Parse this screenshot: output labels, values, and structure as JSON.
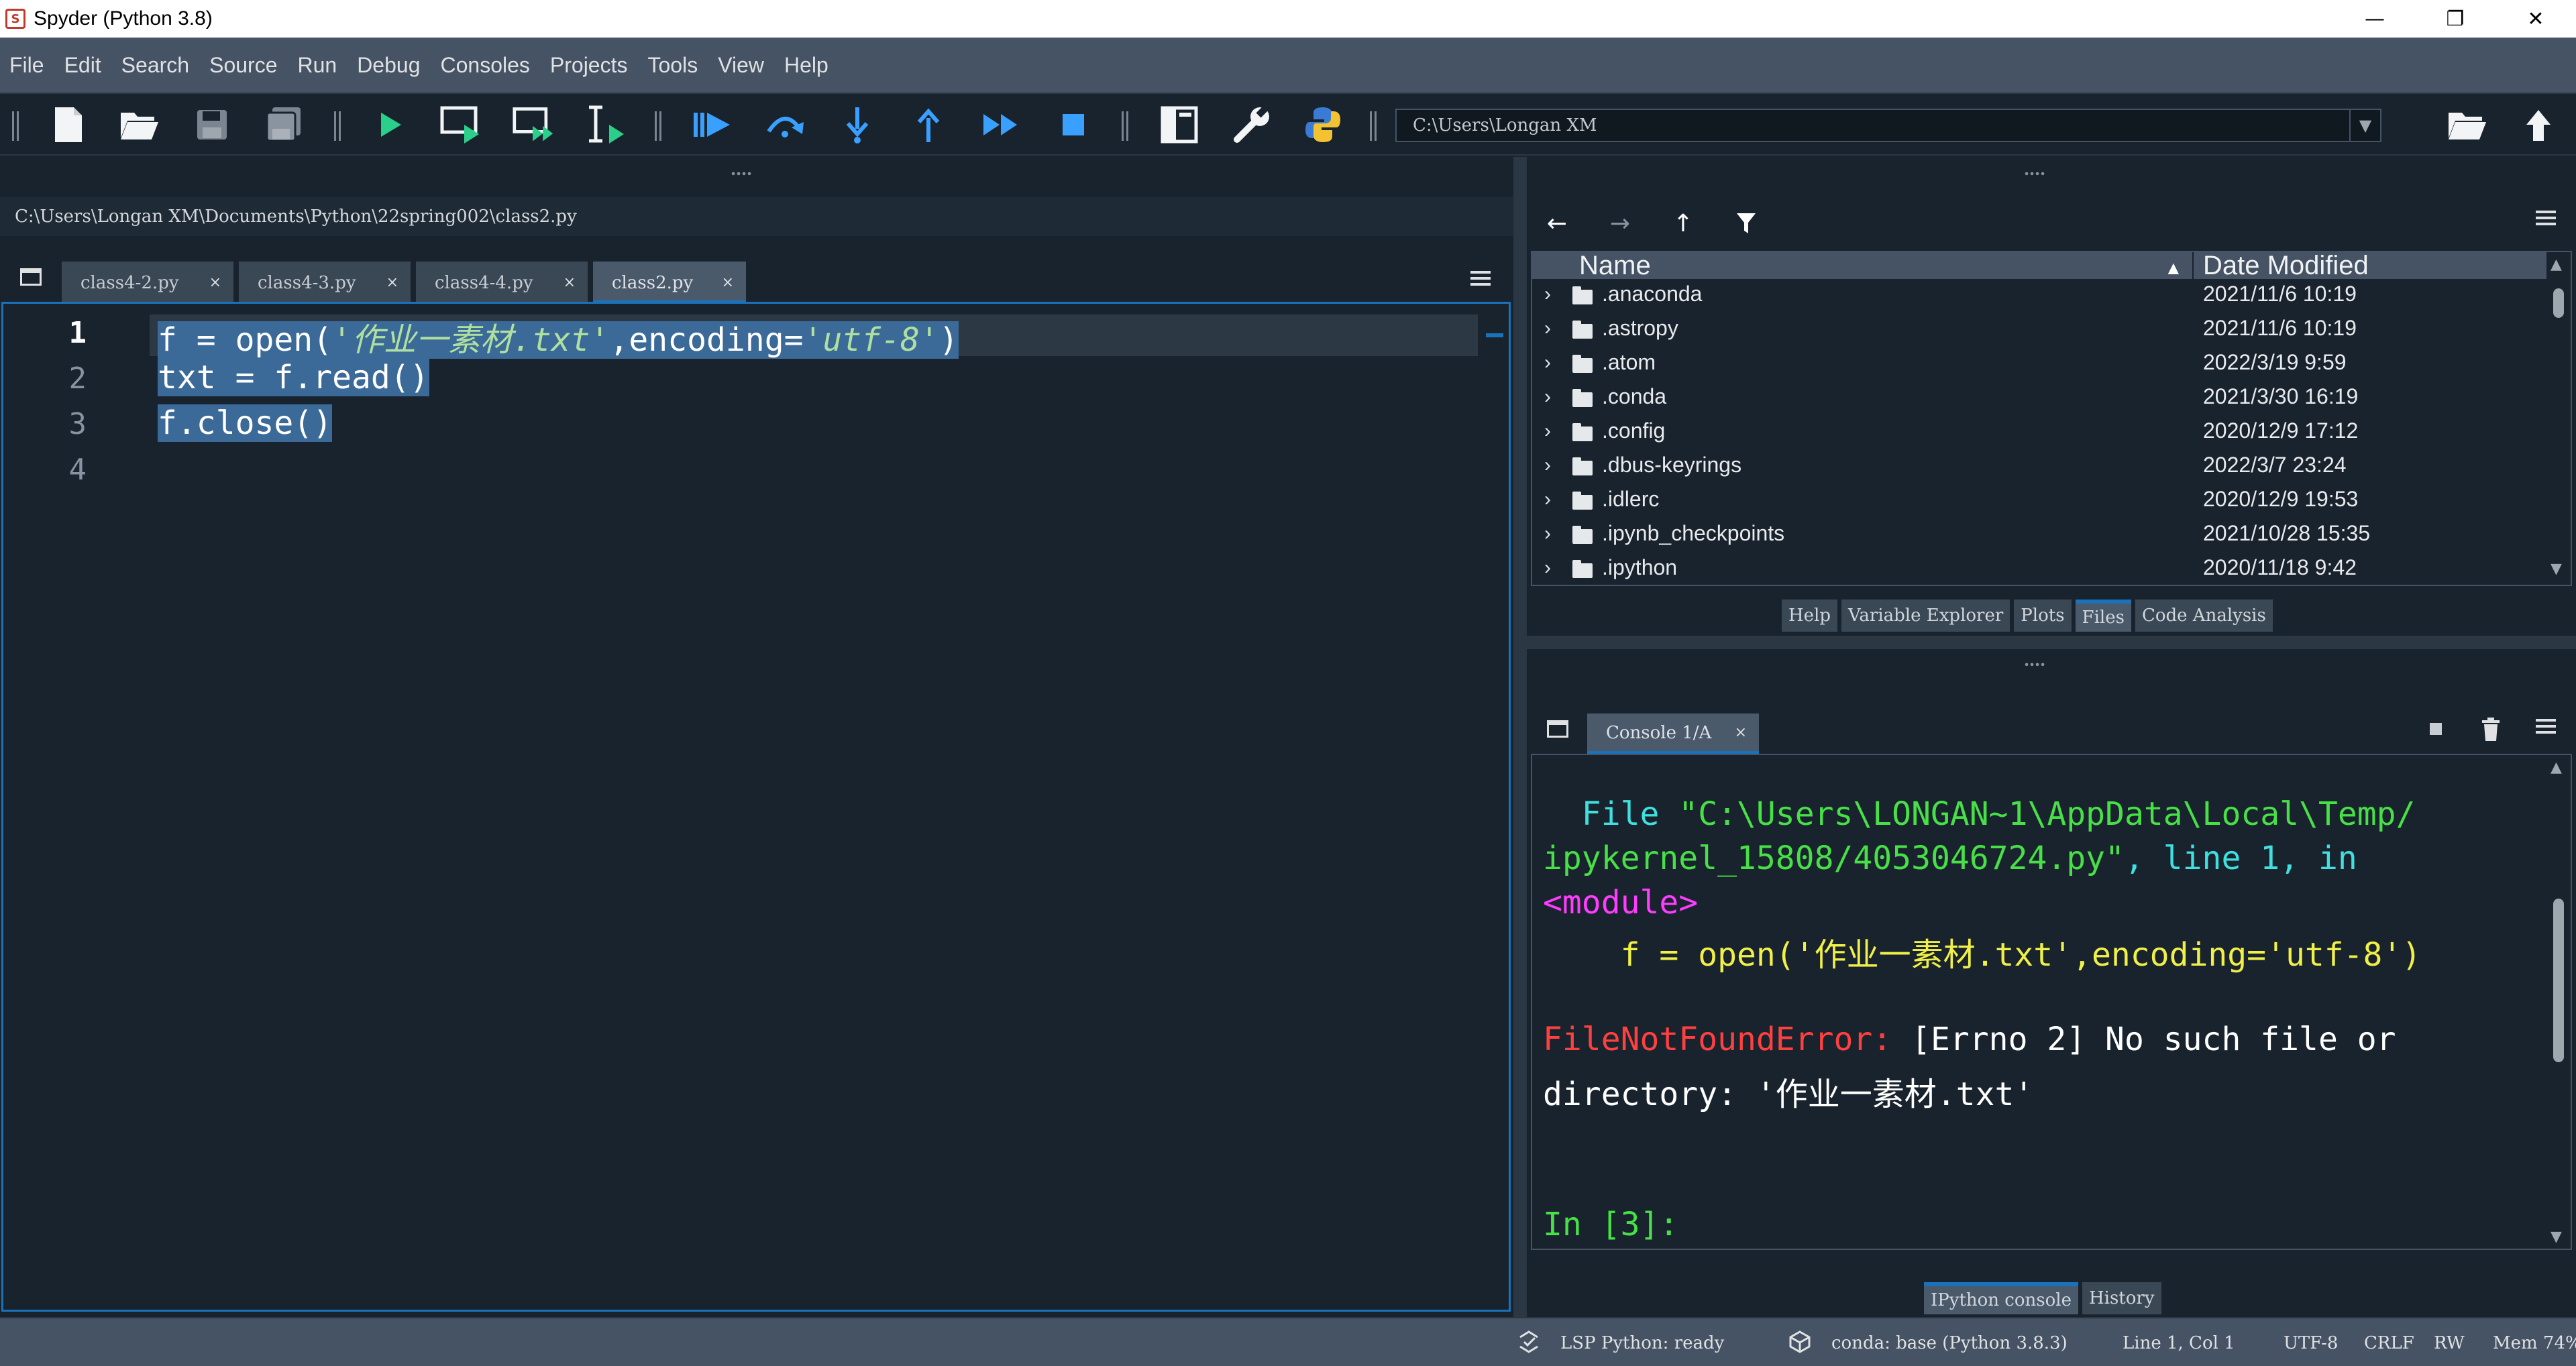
{
  "window": {
    "title": "Spyder (Python 3.8)",
    "minimize": "—",
    "maximize": "❐",
    "close": "✕"
  },
  "menu": [
    "File",
    "Edit",
    "Search",
    "Source",
    "Run",
    "Debug",
    "Consoles",
    "Projects",
    "Tools",
    "View",
    "Help"
  ],
  "toolbar": {
    "working_directory": "C:\\Users\\Longan XM",
    "icons": [
      "new-file-icon",
      "open-file-icon",
      "save-icon",
      "save-all-icon",
      "run-icon",
      "run-cell-icon",
      "run-cell-advance-icon",
      "run-selection-icon",
      "debug-icon",
      "step-over-icon",
      "step-into-icon",
      "step-return-icon",
      "continue-icon",
      "stop-icon",
      "maximize-pane-icon",
      "preferences-icon",
      "python-path-icon",
      "browse-folder-icon",
      "parent-dir-icon"
    ]
  },
  "editor": {
    "file_path": "C:\\Users\\Longan XM\\Documents\\Python\\22spring002\\class2.py",
    "tabs": [
      {
        "label": "class4-2.py",
        "close": "×"
      },
      {
        "label": "class4-3.py",
        "close": "×"
      },
      {
        "label": "class4-4.py",
        "close": "×"
      },
      {
        "label": "class2.py",
        "close": "×"
      }
    ],
    "line_numbers": [
      "1",
      "2",
      "3",
      "4"
    ],
    "code": {
      "l1_pre": "f = open(",
      "l1_str1": "'作业一素材.txt'",
      "l1_mid": ",encoding=",
      "l1_str2": "'utf-8'",
      "l1_post": ")",
      "l2": "txt = f.read()",
      "l3": "f.close()"
    }
  },
  "files": {
    "header_name": "Name",
    "header_date": "Date Modified",
    "rows": [
      {
        "name": ".anaconda",
        "date": "2021/11/6 10:19"
      },
      {
        "name": ".astropy",
        "date": "2021/11/6 10:19"
      },
      {
        "name": ".atom",
        "date": "2022/3/19 9:59"
      },
      {
        "name": ".conda",
        "date": "2021/3/30 16:19"
      },
      {
        "name": ".config",
        "date": "2020/12/9 17:12"
      },
      {
        "name": ".dbus-keyrings",
        "date": "2022/3/7 23:24"
      },
      {
        "name": ".idlerc",
        "date": "2020/12/9 19:53"
      },
      {
        "name": ".ipynb_checkpoints",
        "date": "2021/10/28 15:35"
      },
      {
        "name": ".ipython",
        "date": "2020/11/18 9:42"
      }
    ],
    "pane_tabs": [
      "Help",
      "Variable Explorer",
      "Plots",
      "Files",
      "Code Analysis"
    ]
  },
  "console": {
    "tab_label": "Console 1/A",
    "tab_close": "×",
    "traceback": {
      "file_kw": "  File ",
      "file_path_1": "\"C:\\Users\\LONGAN~1\\AppData\\Local\\Temp/",
      "file_path_2": "ipykernel_15808/4053046724.py\"",
      "line_kw": ", line 1, in",
      "module": "<module>",
      "code_line": "    f = open('作业一素材.txt',encoding='utf-8')",
      "error_name": "FileNotFoundError:",
      "error_msg_1": " [Errno 2] No such file or",
      "error_msg_2": "directory: '作业一素材.txt'",
      "prompt": "In [3]:"
    },
    "pane_tabs": [
      "IPython console",
      "History"
    ]
  },
  "status": {
    "lsp": "LSP Python: ready",
    "conda": "conda: base (Python 3.8.3)",
    "position": "Line 1, Col 1",
    "encoding": "UTF-8",
    "eol": "CRLF",
    "permissions": "RW",
    "memory": "Mem 74%"
  },
  "colors": {
    "accent": "#1a72bb",
    "background": "#19232d",
    "panel": "#455364"
  }
}
